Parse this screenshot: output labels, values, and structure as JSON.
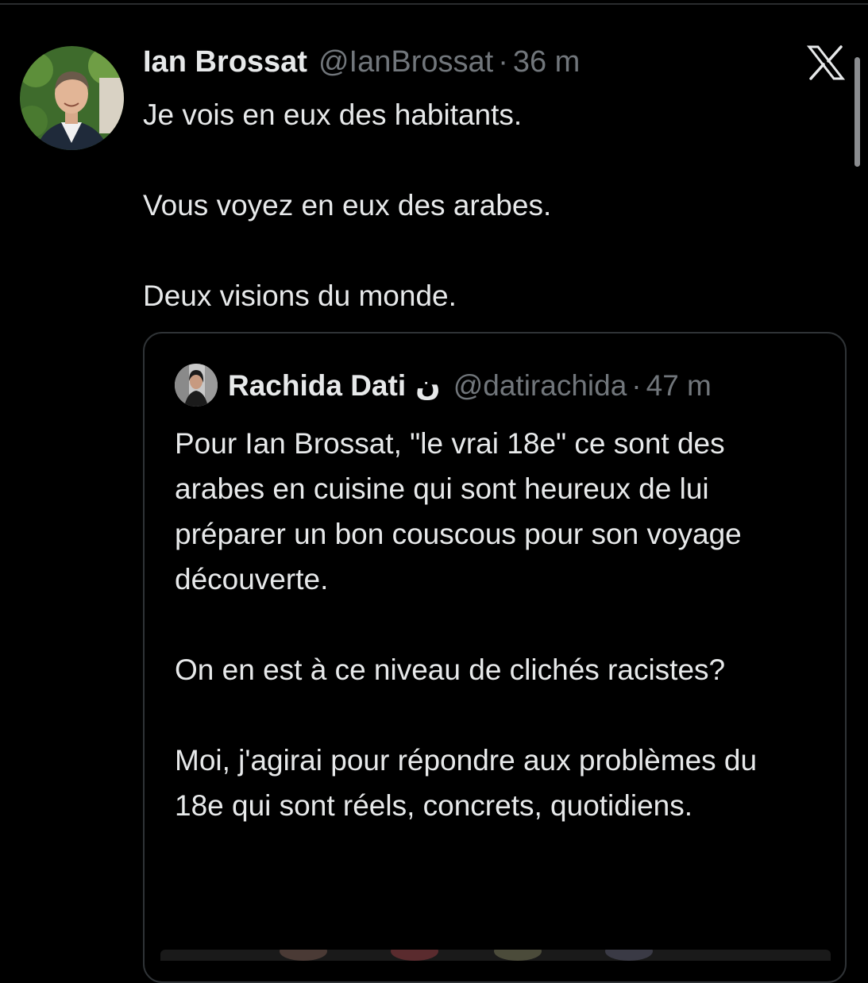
{
  "tweet": {
    "author_name": "Ian Brossat",
    "author_handle": "@IanBrossat",
    "separator": "·",
    "time": "36 m",
    "paragraphs": [
      "Je vois en eux des habitants.",
      "Vous voyez en eux des arabes.",
      "Deux visions du monde."
    ]
  },
  "quote": {
    "author_name": "Rachida Dati",
    "badge": "ن",
    "author_handle": "@datirachida",
    "separator": "·",
    "time": "47 m",
    "paragraphs": [
      "Pour Ian Brossat, \"le vrai 18e\" ce sont des arabes en cuisine qui sont heureux de lui préparer un bon couscous pour son voyage découverte.",
      "On en est à ce niveau de clichés racistes?",
      "Moi, j'agirai pour répondre aux problèmes du 18e qui sont réels, concrets, quotidiens."
    ]
  },
  "icons": {
    "brand": "x-logo-icon"
  },
  "colors": {
    "background": "#000000",
    "text_primary": "#e7e9ea",
    "text_secondary": "#71767b",
    "border": "#2f3336"
  }
}
